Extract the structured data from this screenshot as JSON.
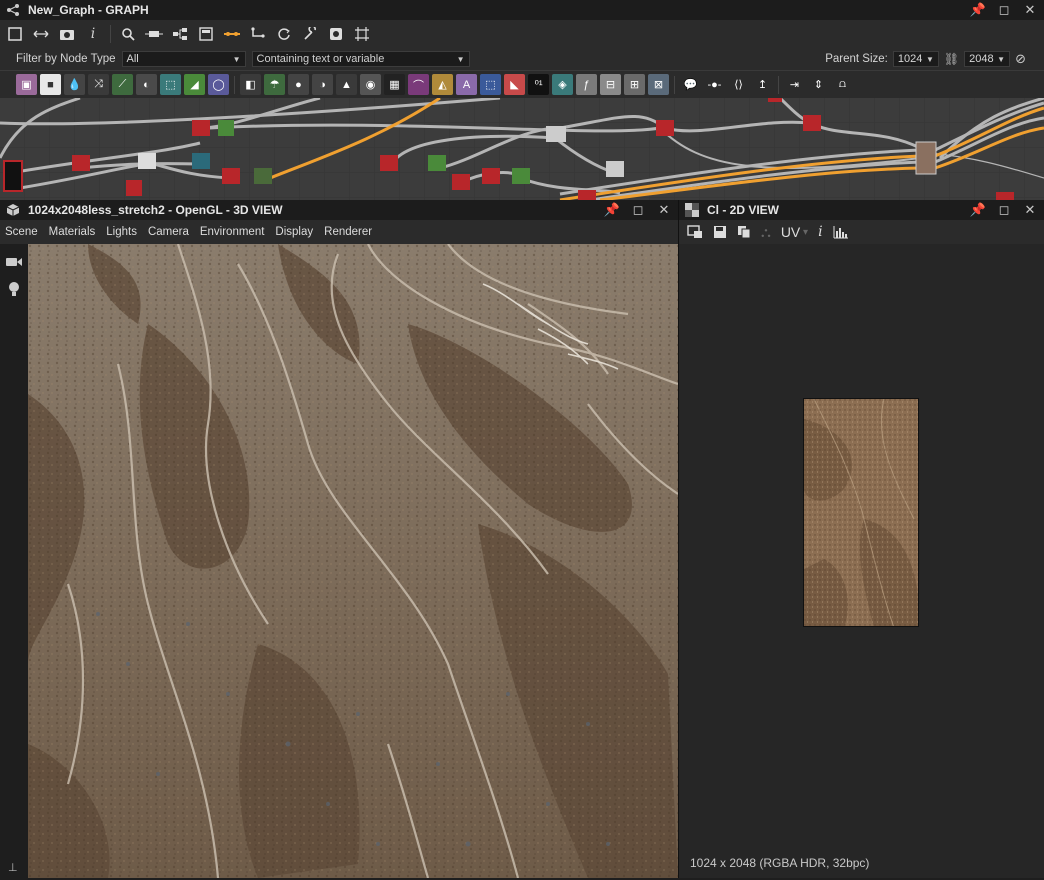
{
  "graph_panel": {
    "title": "New_Graph - GRAPH",
    "filter": {
      "label": "Filter by Node Type",
      "value": "All",
      "contains_placeholder": "Containing text or variable"
    },
    "parent_size": {
      "label": "Parent Size:",
      "width": "1024",
      "height": "2048"
    }
  },
  "view3d": {
    "title": "1024x2048less_stretch2 - OpenGL - 3D VIEW",
    "menu": [
      "Scene",
      "Materials",
      "Lights",
      "Camera",
      "Environment",
      "Display",
      "Renderer"
    ]
  },
  "view2d": {
    "title": "Cl - 2D VIEW",
    "uv_label": "UV",
    "status": "1024 x 2048 (RGBA HDR, 32bpc)"
  },
  "colors": {
    "panel_bg": "#2b2b2b",
    "title_bg": "#1c1c1c",
    "graph_bg": "#3c3c3c",
    "wire": "#b5b5b5",
    "wire_orange": "#f0a030",
    "node_red": "#b8262a"
  }
}
